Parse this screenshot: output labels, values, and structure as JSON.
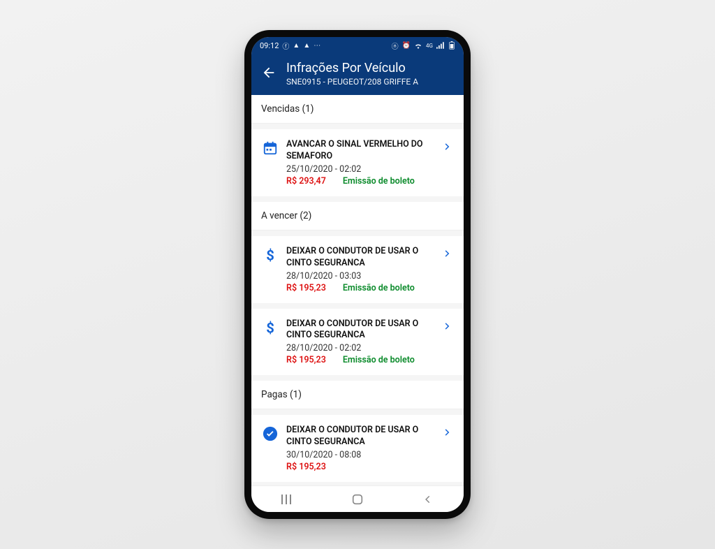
{
  "statusbar": {
    "time": "09:12",
    "network_label": "4G"
  },
  "appbar": {
    "title": "Infrações Por Veículo",
    "subtitle": "SNE0915 - PEUGEOT/208 GRIFFE A"
  },
  "sections": {
    "expired": {
      "header": "Vencidas (1)"
    },
    "upcoming": {
      "header": "A vencer (2)"
    },
    "paid": {
      "header": "Pagas (1)"
    }
  },
  "items": {
    "expired0": {
      "title": "AVANCAR O SINAL VERMELHO DO SEMAFORO",
      "date": "25/10/2020 - 02:02",
      "amount": "R$ 293,47",
      "status": "Emissão de boleto"
    },
    "upcoming0": {
      "title": "DEIXAR O CONDUTOR DE USAR O CINTO SEGURANCA",
      "date": "28/10/2020 - 03:03",
      "amount": "R$ 195,23",
      "status": "Emissão de boleto"
    },
    "upcoming1": {
      "title": "DEIXAR O CONDUTOR DE USAR O CINTO SEGURANCA",
      "date": "28/10/2020 - 02:02",
      "amount": "R$ 195,23",
      "status": "Emissão de boleto"
    },
    "paid0": {
      "title": "DEIXAR O CONDUTOR DE USAR O CINTO SEGURANCA",
      "date": "30/10/2020 - 08:08",
      "amount": "R$ 195,23"
    }
  },
  "colors": {
    "primary": "#0a3a7a",
    "accent_blue": "#1565d8",
    "amount_red": "#d11",
    "status_green": "#0a8a2a"
  }
}
